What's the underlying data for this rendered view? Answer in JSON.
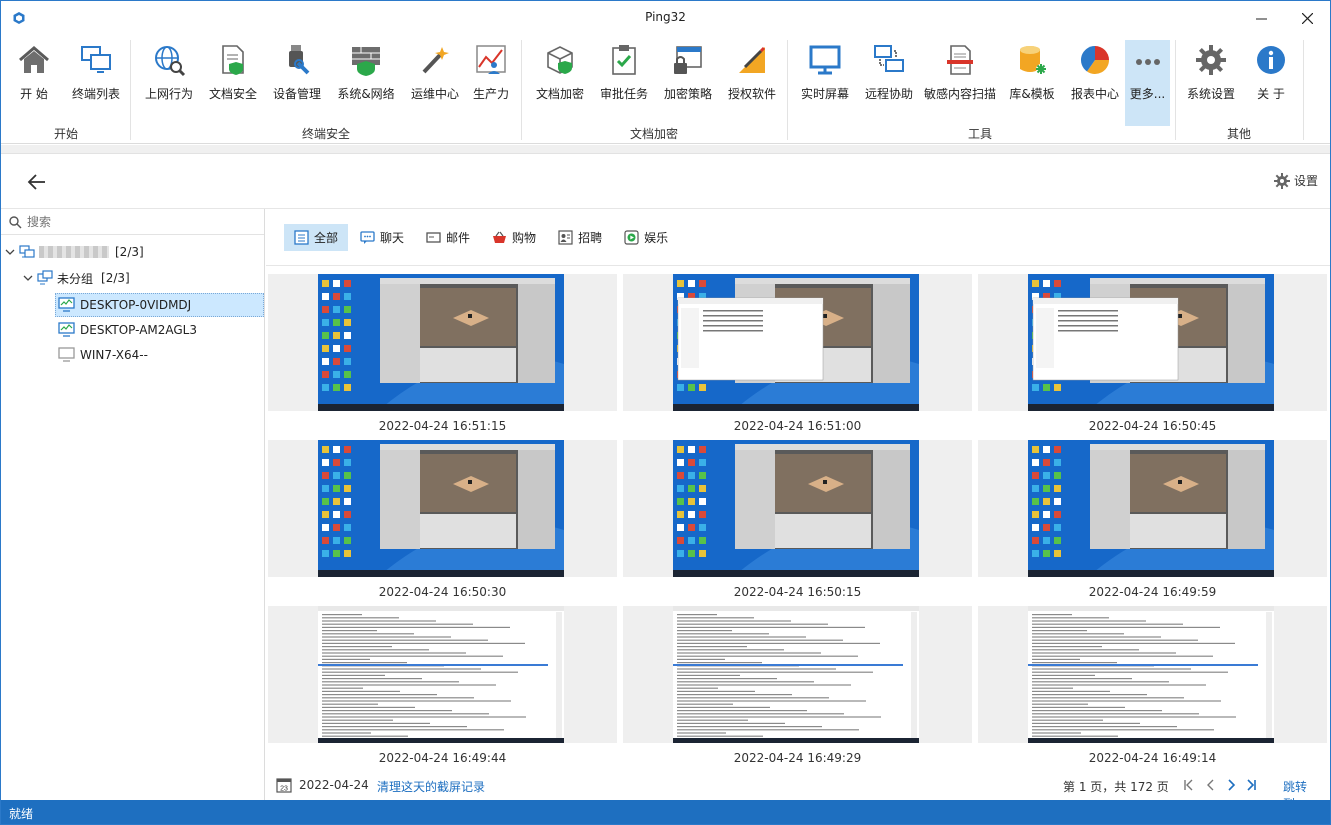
{
  "window": {
    "title": "Ping32"
  },
  "ribbon": {
    "buttons": [
      {
        "label": "开 始",
        "icon": "home-icon"
      },
      {
        "label": "终端列表",
        "icon": "terminal-list-icon"
      },
      {
        "label": "上网行为",
        "icon": "web-behavior-icon"
      },
      {
        "label": "文档安全",
        "icon": "document-security-icon"
      },
      {
        "label": "设备管理",
        "icon": "device-management-icon"
      },
      {
        "label": "系统&网络",
        "icon": "system-network-icon"
      },
      {
        "label": "运维中心",
        "icon": "ops-center-icon"
      },
      {
        "label": "生产力",
        "icon": "productivity-icon"
      },
      {
        "label": "文档加密",
        "icon": "document-encryption-icon"
      },
      {
        "label": "审批任务",
        "icon": "approval-task-icon"
      },
      {
        "label": "加密策略",
        "icon": "encryption-policy-icon"
      },
      {
        "label": "授权软件",
        "icon": "licensed-software-icon"
      },
      {
        "label": "实时屏幕",
        "icon": "realtime-screen-icon"
      },
      {
        "label": "远程协助",
        "icon": "remote-assist-icon"
      },
      {
        "label": "敏感内容扫描",
        "icon": "sensitive-scan-icon"
      },
      {
        "label": "库&模板",
        "icon": "library-template-icon"
      },
      {
        "label": "报表中心",
        "icon": "report-center-icon"
      },
      {
        "label": "更多...",
        "icon": "more-icon"
      },
      {
        "label": "系统设置",
        "icon": "system-settings-icon"
      },
      {
        "label": "关 于",
        "icon": "about-icon"
      }
    ],
    "groups": [
      "开始",
      "终端安全",
      "文档加密",
      "工具",
      "其他"
    ]
  },
  "nav": {
    "settings_label": "设置"
  },
  "sidebar": {
    "search_placeholder": "搜索",
    "root": {
      "name": "",
      "count": "[2/3]"
    },
    "group": {
      "name": "未分组",
      "count": "[2/3]"
    },
    "devices": [
      {
        "name": "DESKTOP-0VIDMDJ",
        "online": true
      },
      {
        "name": "DESKTOP-AM2AGL3",
        "online": true
      },
      {
        "name": "WIN7-X64--",
        "online": false
      }
    ]
  },
  "tabs": [
    {
      "label": "全部",
      "icon": "all-icon"
    },
    {
      "label": "聊天",
      "icon": "chat-icon"
    },
    {
      "label": "邮件",
      "icon": "mail-icon"
    },
    {
      "label": "购物",
      "icon": "shopping-icon"
    },
    {
      "label": "招聘",
      "icon": "recruit-icon"
    },
    {
      "label": "娱乐",
      "icon": "entertainment-icon"
    }
  ],
  "screenshots": [
    {
      "time": "2022-04-24 16:51:15",
      "kind": "desktop"
    },
    {
      "time": "2022-04-24 16:51:00",
      "kind": "explorer"
    },
    {
      "time": "2022-04-24 16:50:45",
      "kind": "explorer"
    },
    {
      "time": "2022-04-24 16:50:30",
      "kind": "desktop"
    },
    {
      "time": "2022-04-24 16:50:15",
      "kind": "desktop"
    },
    {
      "time": "2022-04-24 16:49:59",
      "kind": "desktop"
    },
    {
      "time": "2022-04-24 16:49:44",
      "kind": "log"
    },
    {
      "time": "2022-04-24 16:49:29",
      "kind": "log"
    },
    {
      "time": "2022-04-24 16:49:14",
      "kind": "log"
    }
  ],
  "footer": {
    "date": "2022-04-24",
    "clear_link": "清理这天的截屏记录",
    "page_info": "第 1 页，共 172 页",
    "jump_link": "跳转到..."
  },
  "status": {
    "text": "就绪"
  },
  "colors": {
    "accent": "#1e6fc0",
    "selected": "#cde5f7"
  }
}
